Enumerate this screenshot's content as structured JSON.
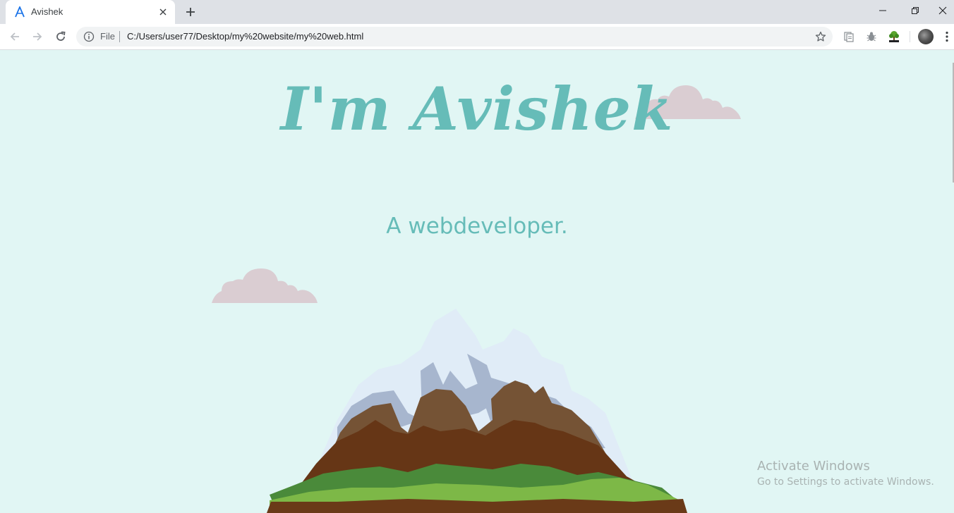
{
  "browser": {
    "tab": {
      "title": "Avishek"
    },
    "omnibox": {
      "scheme_label": "File",
      "url": "C:/Users/user77/Desktop/my%20website/my%20web.html"
    }
  },
  "page": {
    "title": "I'm Avishek",
    "subtitle": "A webdeveloper.",
    "colors": {
      "background": "#e1f6f4",
      "accent": "#66bcb8",
      "cloud": "#dacdd2"
    }
  },
  "watermark": {
    "title": "Activate Windows",
    "subtitle": "Go to Settings to activate Windows."
  }
}
